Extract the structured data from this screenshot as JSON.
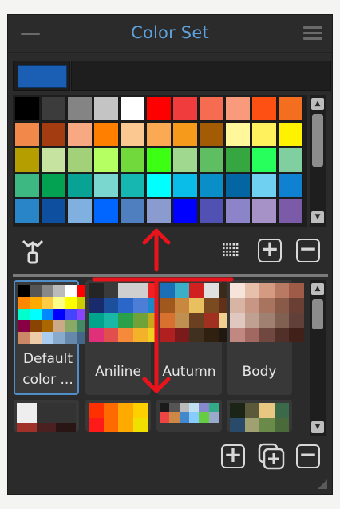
{
  "panel": {
    "title": "Color Set",
    "current_color": "#1a5fb4",
    "name_value": ""
  },
  "icons": {
    "menu_left": "minus-icon",
    "menu_right": "hamburger-icon",
    "dropper": "eyedropper-icon",
    "grid_view": "grid-dots-icon",
    "add": "plus-icon",
    "remove": "minus-icon",
    "duplicate": "duplicate-plus-icon",
    "resize": "resize-grip-icon"
  },
  "swatches": [
    "#000000",
    "#3c3c3c",
    "#848484",
    "#c4c4c4",
    "#ffffff",
    "#ff0000",
    "#f03c3c",
    "#f66c50",
    "#fa9a7c",
    "#ff5014",
    "#f46e20",
    "#f2894a",
    "#a33c10",
    "#f9a982",
    "#ff8000",
    "#fbc891",
    "#fbaa53",
    "#f59a1a",
    "#a45c04",
    "#fef89b",
    "#fff05e",
    "#fff200",
    "#b49e00",
    "#c7e3a0",
    "#a2d17a",
    "#b5ff63",
    "#72d93c",
    "#3cff14",
    "#a0d890",
    "#5fbd62",
    "#36a640",
    "#26ff5c",
    "#80cfa0",
    "#3db883",
    "#03a253",
    "#08a394",
    "#79d7cf",
    "#16b7b1",
    "#00ffff",
    "#0abde8",
    "#0a8ec8",
    "#0366a2",
    "#6fd0f2",
    "#1080d0",
    "#2a84c8",
    "#0f4f9f",
    "#7fb0df",
    "#0066ff",
    "#4f7fbe",
    "#8a9bd0",
    "#0000ff",
    "#5051b3",
    "#8c84c8",
    "#a792c8",
    "#7b5aa8"
  ],
  "color_sets": [
    {
      "label": "Default color ...",
      "selected": true
    },
    {
      "label": "Aniline",
      "selected": false
    },
    {
      "label": "Autumn",
      "selected": false
    },
    {
      "label": "Body",
      "selected": false
    }
  ],
  "set_palettes": {
    "default": [
      "#000",
      "#555",
      "#888",
      "#bbb",
      "#fff",
      "#f00",
      "#f55",
      "#f84",
      "#fa8",
      "#f60",
      "#f80",
      "#fa0",
      "#fc4",
      "#ff8",
      "#ff0",
      "#cc0",
      "#8c0",
      "#4f0",
      "#0f0",
      "#0c6",
      "#0fc",
      "#0ff",
      "#08f",
      "#00f",
      "#44f",
      "#84f",
      "#c4f",
      "#f0f",
      "#f48",
      "#c08",
      "#804",
      "#840",
      "#a60",
      "#ca8",
      "#8a6",
      "#486",
      "#468",
      "#246",
      "#424",
      "#642",
      "#c86",
      "#eca",
      "#ace",
      "#8ac",
      "#68a",
      "#468",
      "#864",
      "#a86",
      "#ccc",
      "#999"
    ],
    "aniline": [
      "#252525",
      "#3a3a3a",
      "#cfcfcf",
      "#cfcfcf",
      "#e22",
      "#1a2b6b",
      "#1c4f9c",
      "#2b67c8",
      "#4c7ed8",
      "#1c88c8",
      "#00a38c",
      "#19b8a6",
      "#2ba04b",
      "#6fa33a",
      "#c7a81a",
      "#e0307a",
      "#e04e4e",
      "#f48a3a",
      "#f4b22a",
      "#f0d020"
    ],
    "autumn": [
      "#1b6fb7",
      "#3bafc8",
      "#d02020",
      "#e0e0e0",
      "#3a2a1a",
      "#a0581c",
      "#c88840",
      "#e8c060",
      "#7a4a20",
      "#603018",
      "#d87030",
      "#c09050",
      "#6a4020",
      "#a03020",
      "#f0d090",
      "#b02020",
      "#7a1a1a",
      "#403020",
      "#302010",
      "#201810"
    ],
    "body": [
      "#f6e4da",
      "#e6c0aa",
      "#d49a82",
      "#b87a62",
      "#a05a48",
      "#d8b4a4",
      "#c89684",
      "#a87460",
      "#8a5a48",
      "#6a4034",
      "#e0c8c0",
      "#c0a090",
      "#a08070",
      "#806050",
      "#604038",
      "#c08880",
      "#a06860",
      "#704840",
      "#503028",
      "#402018"
    ]
  },
  "mini_palettes": {
    "m1": [
      "#eeeeee",
      "#333333",
      "#333333",
      "#a0302a",
      "#4a2020",
      "#2a1515"
    ],
    "m2": [
      "#ff3000",
      "#ff6a00",
      "#ffaa00",
      "#ffd000",
      "#ff1a1a",
      "#ff6a00",
      "#ffaa00",
      "#f0e000"
    ],
    "m3": [
      "#1a1a1a",
      "#555",
      "#bbb",
      "#c0e0f0",
      "#88c",
      "#3a8",
      "#e44",
      "#c84",
      "#48c",
      "#8cf",
      "#6c4",
      "#9ac"
    ],
    "m4": [
      "#1c2418",
      "#5a5a3a",
      "#e8c880",
      "#3a6a4a",
      "#2a4a6a",
      "#a0a070",
      "#6a8a4a",
      "#4a6a3a"
    ]
  }
}
